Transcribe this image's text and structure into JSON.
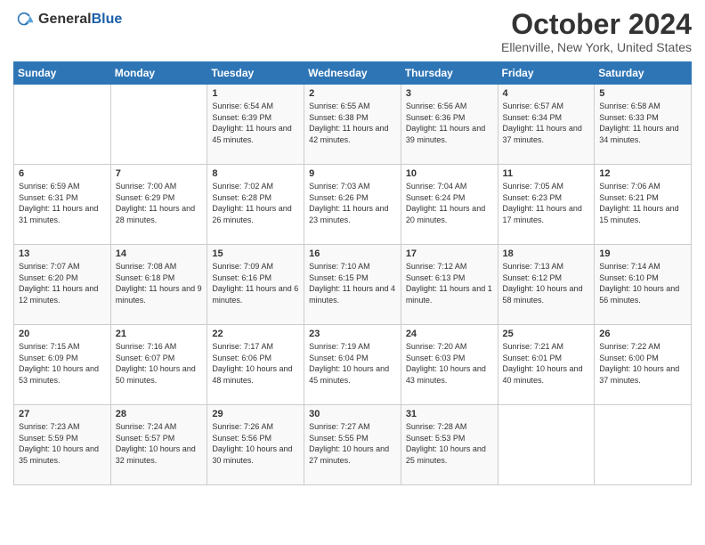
{
  "header": {
    "logo_general": "General",
    "logo_blue": "Blue",
    "month_title": "October 2024",
    "location": "Ellenville, New York, United States"
  },
  "weekdays": [
    "Sunday",
    "Monday",
    "Tuesday",
    "Wednesday",
    "Thursday",
    "Friday",
    "Saturday"
  ],
  "weeks": [
    [
      {
        "day": "",
        "sunrise": "",
        "sunset": "",
        "daylight": ""
      },
      {
        "day": "",
        "sunrise": "",
        "sunset": "",
        "daylight": ""
      },
      {
        "day": "1",
        "sunrise": "Sunrise: 6:54 AM",
        "sunset": "Sunset: 6:39 PM",
        "daylight": "Daylight: 11 hours and 45 minutes."
      },
      {
        "day": "2",
        "sunrise": "Sunrise: 6:55 AM",
        "sunset": "Sunset: 6:38 PM",
        "daylight": "Daylight: 11 hours and 42 minutes."
      },
      {
        "day": "3",
        "sunrise": "Sunrise: 6:56 AM",
        "sunset": "Sunset: 6:36 PM",
        "daylight": "Daylight: 11 hours and 39 minutes."
      },
      {
        "day": "4",
        "sunrise": "Sunrise: 6:57 AM",
        "sunset": "Sunset: 6:34 PM",
        "daylight": "Daylight: 11 hours and 37 minutes."
      },
      {
        "day": "5",
        "sunrise": "Sunrise: 6:58 AM",
        "sunset": "Sunset: 6:33 PM",
        "daylight": "Daylight: 11 hours and 34 minutes."
      }
    ],
    [
      {
        "day": "6",
        "sunrise": "Sunrise: 6:59 AM",
        "sunset": "Sunset: 6:31 PM",
        "daylight": "Daylight: 11 hours and 31 minutes."
      },
      {
        "day": "7",
        "sunrise": "Sunrise: 7:00 AM",
        "sunset": "Sunset: 6:29 PM",
        "daylight": "Daylight: 11 hours and 28 minutes."
      },
      {
        "day": "8",
        "sunrise": "Sunrise: 7:02 AM",
        "sunset": "Sunset: 6:28 PM",
        "daylight": "Daylight: 11 hours and 26 minutes."
      },
      {
        "day": "9",
        "sunrise": "Sunrise: 7:03 AM",
        "sunset": "Sunset: 6:26 PM",
        "daylight": "Daylight: 11 hours and 23 minutes."
      },
      {
        "day": "10",
        "sunrise": "Sunrise: 7:04 AM",
        "sunset": "Sunset: 6:24 PM",
        "daylight": "Daylight: 11 hours and 20 minutes."
      },
      {
        "day": "11",
        "sunrise": "Sunrise: 7:05 AM",
        "sunset": "Sunset: 6:23 PM",
        "daylight": "Daylight: 11 hours and 17 minutes."
      },
      {
        "day": "12",
        "sunrise": "Sunrise: 7:06 AM",
        "sunset": "Sunset: 6:21 PM",
        "daylight": "Daylight: 11 hours and 15 minutes."
      }
    ],
    [
      {
        "day": "13",
        "sunrise": "Sunrise: 7:07 AM",
        "sunset": "Sunset: 6:20 PM",
        "daylight": "Daylight: 11 hours and 12 minutes."
      },
      {
        "day": "14",
        "sunrise": "Sunrise: 7:08 AM",
        "sunset": "Sunset: 6:18 PM",
        "daylight": "Daylight: 11 hours and 9 minutes."
      },
      {
        "day": "15",
        "sunrise": "Sunrise: 7:09 AM",
        "sunset": "Sunset: 6:16 PM",
        "daylight": "Daylight: 11 hours and 6 minutes."
      },
      {
        "day": "16",
        "sunrise": "Sunrise: 7:10 AM",
        "sunset": "Sunset: 6:15 PM",
        "daylight": "Daylight: 11 hours and 4 minutes."
      },
      {
        "day": "17",
        "sunrise": "Sunrise: 7:12 AM",
        "sunset": "Sunset: 6:13 PM",
        "daylight": "Daylight: 11 hours and 1 minute."
      },
      {
        "day": "18",
        "sunrise": "Sunrise: 7:13 AM",
        "sunset": "Sunset: 6:12 PM",
        "daylight": "Daylight: 10 hours and 58 minutes."
      },
      {
        "day": "19",
        "sunrise": "Sunrise: 7:14 AM",
        "sunset": "Sunset: 6:10 PM",
        "daylight": "Daylight: 10 hours and 56 minutes."
      }
    ],
    [
      {
        "day": "20",
        "sunrise": "Sunrise: 7:15 AM",
        "sunset": "Sunset: 6:09 PM",
        "daylight": "Daylight: 10 hours and 53 minutes."
      },
      {
        "day": "21",
        "sunrise": "Sunrise: 7:16 AM",
        "sunset": "Sunset: 6:07 PM",
        "daylight": "Daylight: 10 hours and 50 minutes."
      },
      {
        "day": "22",
        "sunrise": "Sunrise: 7:17 AM",
        "sunset": "Sunset: 6:06 PM",
        "daylight": "Daylight: 10 hours and 48 minutes."
      },
      {
        "day": "23",
        "sunrise": "Sunrise: 7:19 AM",
        "sunset": "Sunset: 6:04 PM",
        "daylight": "Daylight: 10 hours and 45 minutes."
      },
      {
        "day": "24",
        "sunrise": "Sunrise: 7:20 AM",
        "sunset": "Sunset: 6:03 PM",
        "daylight": "Daylight: 10 hours and 43 minutes."
      },
      {
        "day": "25",
        "sunrise": "Sunrise: 7:21 AM",
        "sunset": "Sunset: 6:01 PM",
        "daylight": "Daylight: 10 hours and 40 minutes."
      },
      {
        "day": "26",
        "sunrise": "Sunrise: 7:22 AM",
        "sunset": "Sunset: 6:00 PM",
        "daylight": "Daylight: 10 hours and 37 minutes."
      }
    ],
    [
      {
        "day": "27",
        "sunrise": "Sunrise: 7:23 AM",
        "sunset": "Sunset: 5:59 PM",
        "daylight": "Daylight: 10 hours and 35 minutes."
      },
      {
        "day": "28",
        "sunrise": "Sunrise: 7:24 AM",
        "sunset": "Sunset: 5:57 PM",
        "daylight": "Daylight: 10 hours and 32 minutes."
      },
      {
        "day": "29",
        "sunrise": "Sunrise: 7:26 AM",
        "sunset": "Sunset: 5:56 PM",
        "daylight": "Daylight: 10 hours and 30 minutes."
      },
      {
        "day": "30",
        "sunrise": "Sunrise: 7:27 AM",
        "sunset": "Sunset: 5:55 PM",
        "daylight": "Daylight: 10 hours and 27 minutes."
      },
      {
        "day": "31",
        "sunrise": "Sunrise: 7:28 AM",
        "sunset": "Sunset: 5:53 PM",
        "daylight": "Daylight: 10 hours and 25 minutes."
      },
      {
        "day": "",
        "sunrise": "",
        "sunset": "",
        "daylight": ""
      },
      {
        "day": "",
        "sunrise": "",
        "sunset": "",
        "daylight": ""
      }
    ]
  ]
}
